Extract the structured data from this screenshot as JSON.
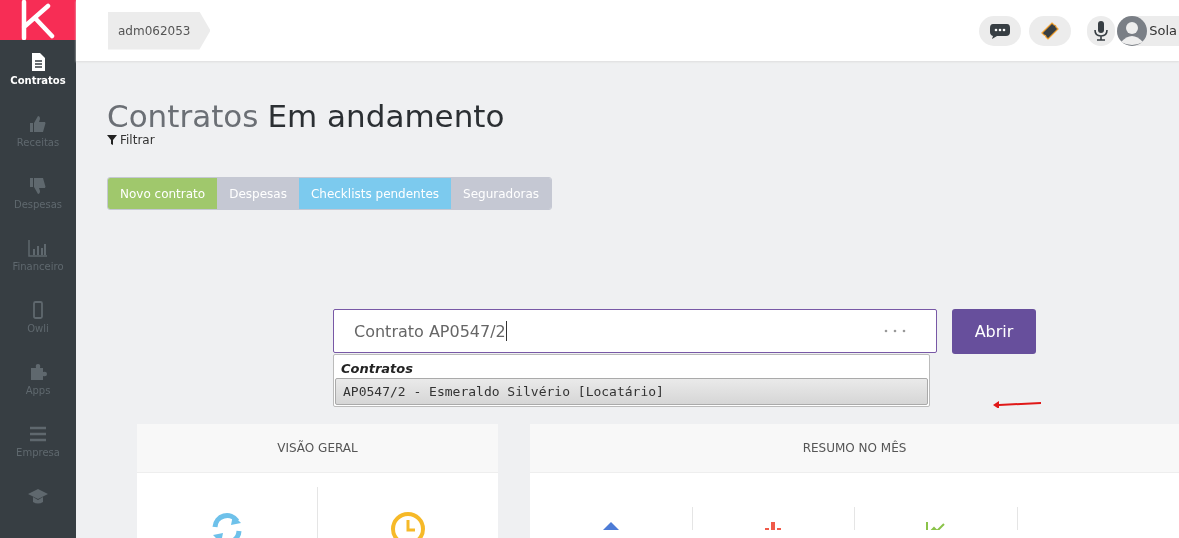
{
  "breadcrumb": "adm062053",
  "user": {
    "name": "Sola"
  },
  "sidebar": {
    "items": [
      {
        "label": "Contratos",
        "selected": true
      },
      {
        "label": "Receitas",
        "selected": false
      },
      {
        "label": "Despesas",
        "selected": false
      },
      {
        "label": "Financeiro",
        "selected": false
      },
      {
        "label": "Owli",
        "selected": false
      },
      {
        "label": "Apps",
        "selected": false
      },
      {
        "label": "Empresa",
        "selected": false
      },
      {
        "selected": false
      }
    ]
  },
  "title": {
    "section": "Contratos",
    "status": "Em andamento"
  },
  "filter_link": "Filtrar",
  "actions": [
    {
      "label": "Novo contrato",
      "color": "#a0c86c"
    },
    {
      "label": "Despesas",
      "color": "#c5c8d3"
    },
    {
      "label": "Checklists pendentes",
      "color": "#7ccaee"
    },
    {
      "label": "Seguradoras",
      "color": "#c5c8d3"
    }
  ],
  "search": {
    "value": "Contrato AP0547/2",
    "button": "Abrir"
  },
  "suggestions": {
    "group": "Contratos",
    "items": [
      {
        "label": "AP0547/2 - Esmeraldo Silvério [Locatário]",
        "selected": true
      }
    ]
  },
  "cards": [
    {
      "title": "VISÃO GERAL"
    },
    {
      "title": "RESUMO NO MÊS"
    }
  ]
}
